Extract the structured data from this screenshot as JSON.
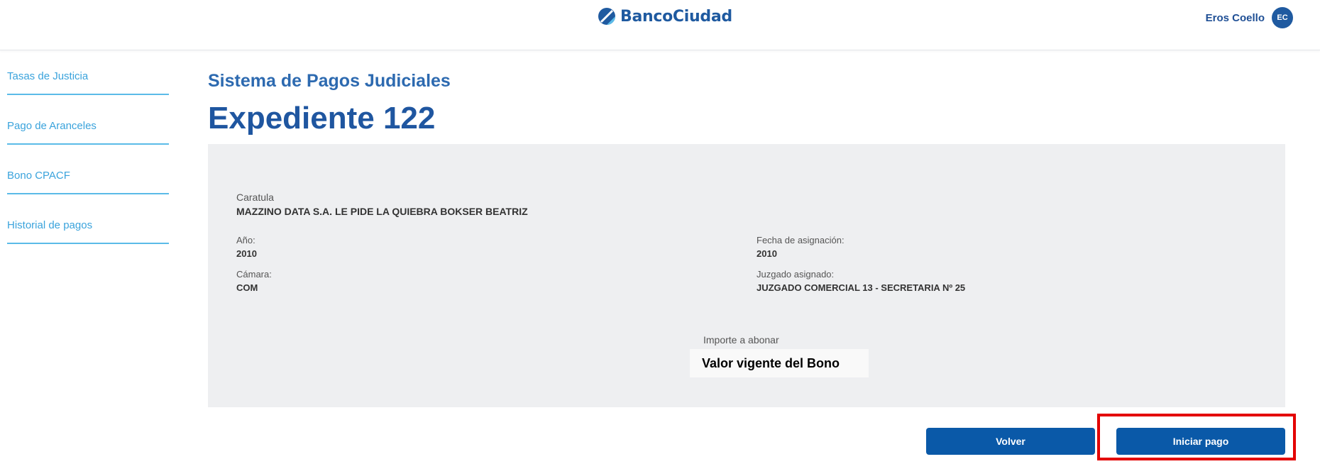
{
  "header": {
    "logo_text": "BancoCiudad",
    "user_name": "Eros Coello",
    "user_initials": "EC"
  },
  "sidebar": {
    "items": [
      {
        "label": "Tasas de Justicia"
      },
      {
        "label": "Pago de Aranceles"
      },
      {
        "label": "Bono CPACF"
      },
      {
        "label": "Historial de pagos"
      }
    ]
  },
  "main": {
    "subtitle": "Sistema de Pagos Judiciales",
    "title": "Expediente 122",
    "caratula_label": "Caratula",
    "caratula_value": "MAZZINO DATA S.A. LE PIDE LA QUIEBRA BOKSER BEATRIZ",
    "fields": {
      "anio_label": "Año:",
      "anio_value": "2010",
      "camara_label": "Cámara:",
      "camara_value": "COM",
      "fecha_label": "Fecha de asignación:",
      "fecha_value": "2010",
      "juzgado_label": "Juzgado asignado:",
      "juzgado_value": "JUZGADO COMERCIAL 13 - SECRETARIA Nº 25"
    },
    "importe_label": "Importe a abonar",
    "importe_value": "Valor vigente del Bono"
  },
  "actions": {
    "volver_label": "Volver",
    "iniciar_label": "Iniciar pago"
  },
  "colors": {
    "brand_blue": "#1f5aa0",
    "button_blue": "#0a59a8",
    "link_blue": "#3aa3dc",
    "highlight_red": "#e30000",
    "panel_bg": "#eeeff1"
  }
}
